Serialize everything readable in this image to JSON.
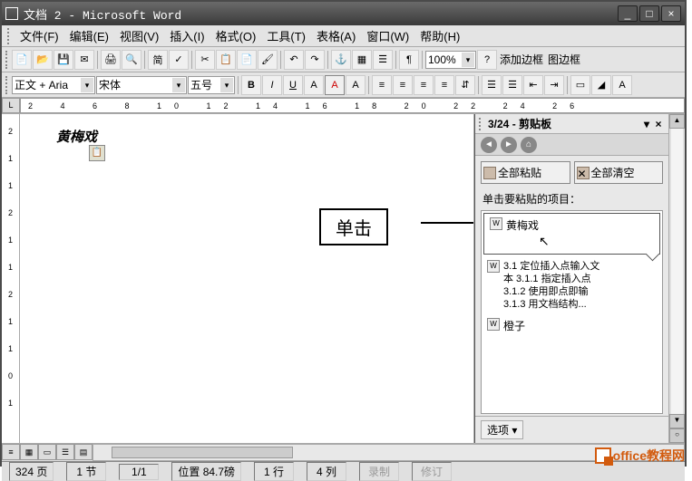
{
  "title": "文档 2 - Microsoft Word",
  "menu": {
    "file": "文件(F)",
    "edit": "编辑(E)",
    "view": "视图(V)",
    "insert": "插入(I)",
    "format": "格式(O)",
    "tools": "工具(T)",
    "table": "表格(A)",
    "window": "窗口(W)",
    "help": "帮助(H)"
  },
  "toolbar1": {
    "zoom": "100%",
    "add_border": "添加边框",
    "image_border": "图边框"
  },
  "toolbar2": {
    "style": "正文 + Aria",
    "font": "宋体",
    "size": "五号",
    "b": "B",
    "i": "I",
    "u": "U",
    "a1": "A",
    "a2": "A",
    "a3": "A"
  },
  "ruler_h": "2  4  6  8  10 12 14 16 18 20 22 24 26",
  "ruler_v": [
    "2",
    "1",
    "1",
    "2",
    "1",
    "1",
    "2",
    "1",
    "1",
    "0",
    "1"
  ],
  "document_text": "黄梅戏",
  "callout": "单击",
  "taskpane": {
    "title": "3/24 - 剪贴板",
    "paste_all": "全部粘贴",
    "clear_all": "全部清空",
    "hint": "单击要粘贴的项目：",
    "item1": "黄梅戏",
    "item2_l1": "3.1 定位插入点输入文",
    "item2_l2": "本 3.1.1 指定插入点",
    "item2_l3": "3.1.2 使用即点即输",
    "item2_l4": "3.1.3 用文档结构...",
    "item3": "橙子",
    "options": "选项 ▾"
  },
  "status": {
    "page": "324 页",
    "section": "1 节",
    "pages": "1/1",
    "position": "位置 84.7磅",
    "line": "1 行",
    "column": "4 列",
    "rec": "录制",
    "rev": "修订"
  },
  "watermark": "office教程网"
}
